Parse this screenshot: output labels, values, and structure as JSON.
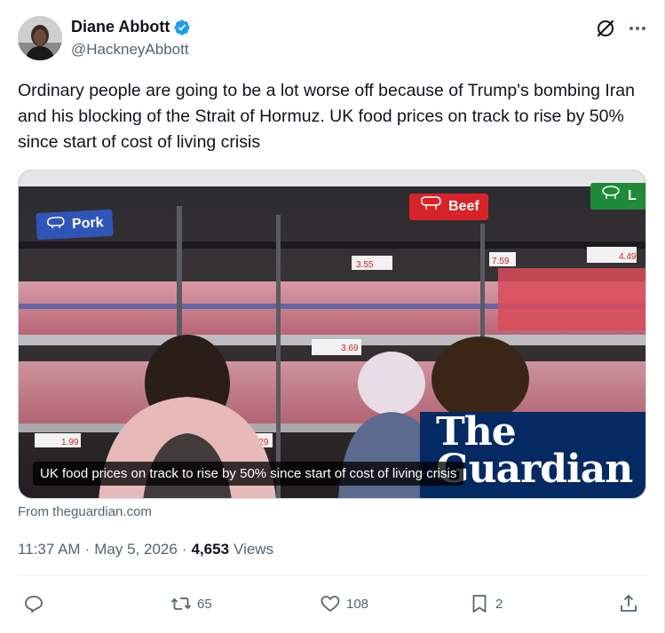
{
  "author": {
    "name": "Diane Abbott",
    "handle": "@HackneyAbbott",
    "verified": true,
    "avatar_icon": "profile-photo"
  },
  "header_icons": {
    "grok": "grok-icon",
    "more": "more-icon"
  },
  "tweet": {
    "text": "Ordinary people are going to be a lot worse off because of Trump's bombing Iran and his blocking of the Strait of Hormuz. UK food prices on track to rise by 50% since start of cost of living crisis"
  },
  "media": {
    "caption": "UK food prices on track to rise by 50% since start of cost of living crisis",
    "publisher_logo": "The Guardian",
    "shelf_labels": [
      "Pork",
      "Beef",
      "L"
    ],
    "price_labels": [
      "3.55",
      "7.59",
      "4.49",
      "3.69",
      "1.99",
      "3.29"
    ]
  },
  "source": "From theguardian.com",
  "meta": {
    "time": "11:37 AM",
    "separator": "·",
    "date": "May 5, 2026",
    "views_count": "4,653",
    "views_label": "Views"
  },
  "actions": {
    "reply_count": "",
    "retweet_count": "65",
    "like_count": "108",
    "bookmark_count": "2"
  },
  "colors": {
    "text_primary": "#0f1419",
    "text_secondary": "#536471",
    "verified_blue": "#1d9bf0",
    "guardian_navy": "#052962"
  }
}
